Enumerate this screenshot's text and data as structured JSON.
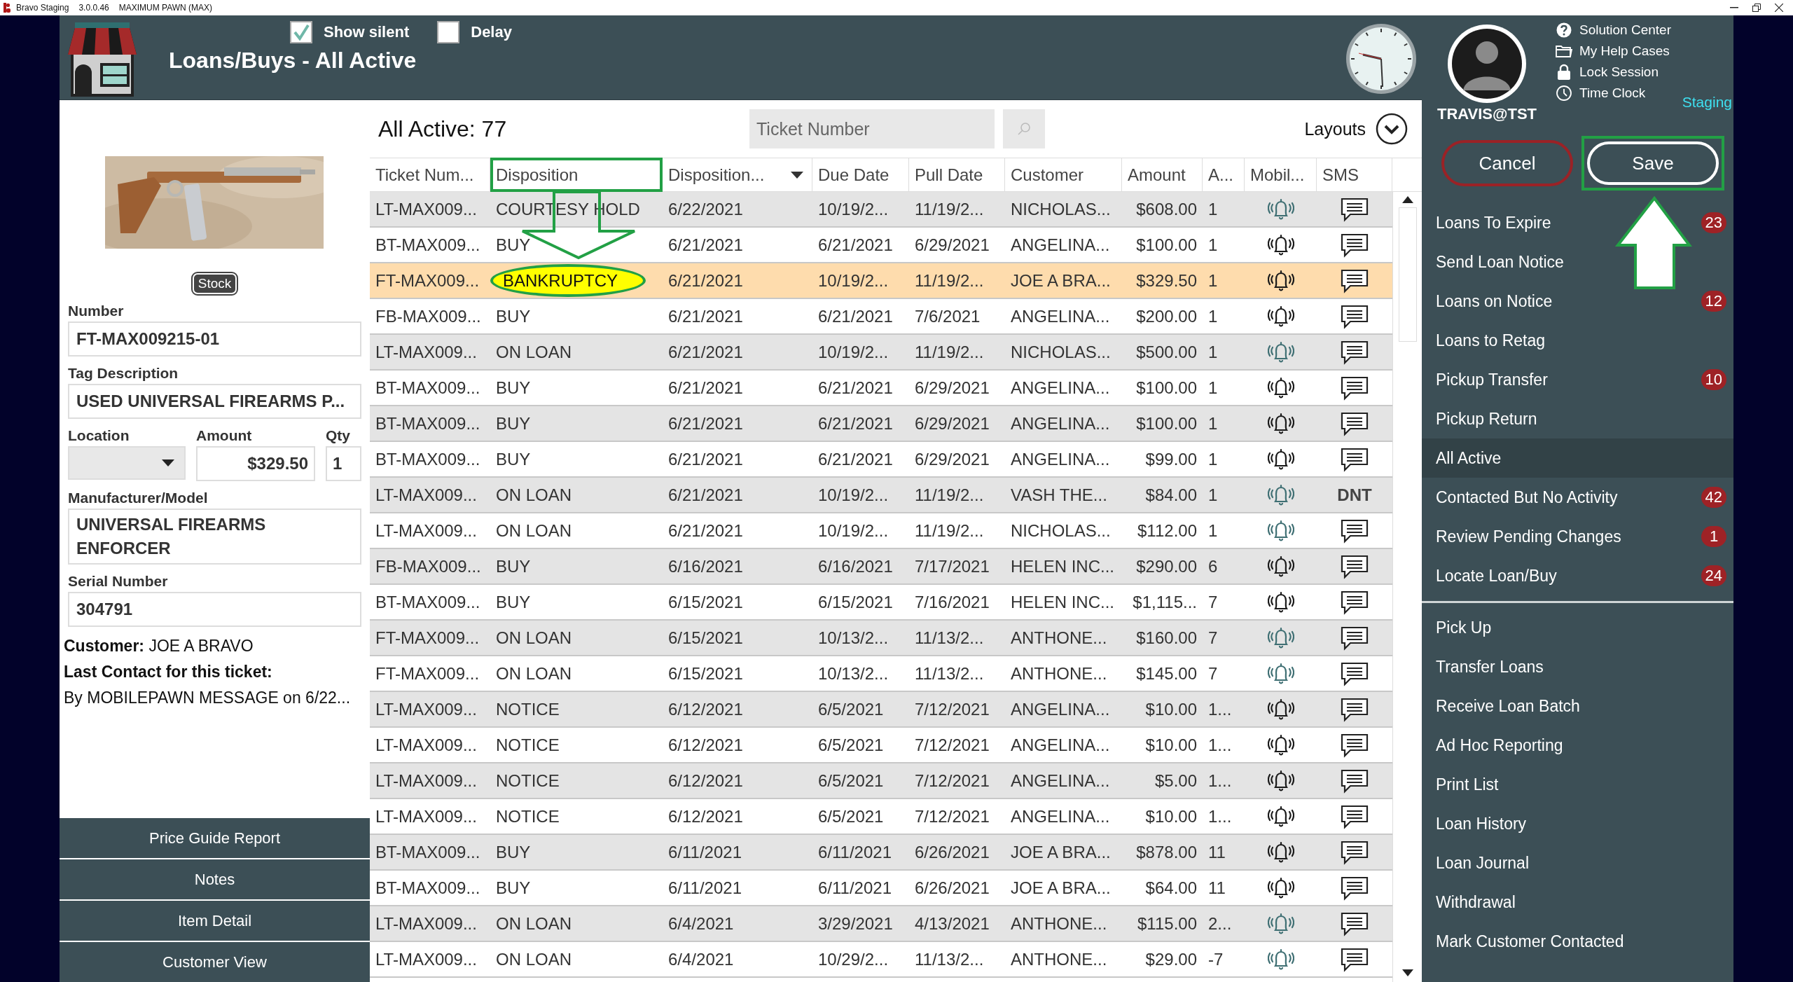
{
  "title_bar": {
    "app": "Bravo Staging",
    "version": "3.0.0.46",
    "store": "MAXIMUM PAWN (MAX)"
  },
  "header": {
    "title": "Loans/Buys - All Active",
    "options": [
      {
        "label": "Show silent",
        "checked": true
      },
      {
        "label": "Delay",
        "checked": false
      }
    ]
  },
  "item": {
    "stock_button": "Stock",
    "number": {
      "label": "Number",
      "value": "FT-MAX009215-01"
    },
    "tag_description": {
      "label": "Tag Description",
      "value": "USED UNIVERSAL FIREARMS P..."
    },
    "location": {
      "label": "Location"
    },
    "amount": {
      "label": "Amount",
      "value": "$329.50"
    },
    "qty": {
      "label": "Qty",
      "value": "1"
    },
    "model": {
      "label": "Manufacturer/Model",
      "value": "UNIVERSAL FIREARMS ENFORCER"
    },
    "serial": {
      "label": "Serial Number",
      "value": "304791"
    },
    "customer": "**Customer:** JOE A BRAVO",
    "last_contact_label": "Last Contact for this ticket:",
    "last_contact": "By MOBILEPAWN MESSAGE on 6/22..."
  },
  "actions": [
    "Price Guide Report",
    "Notes",
    "Item Detail",
    "Customer View"
  ],
  "list": {
    "title": "All Active: 77",
    "search_placeholder": "Ticket Number",
    "layouts": "Layouts",
    "columns": [
      {
        "label": "Ticket Num...",
        "sorted": false,
        "highlighted": false
      },
      {
        "label": "Disposition",
        "sorted": false,
        "highlighted": true
      },
      {
        "label": "Disposition...",
        "sorted": true,
        "highlighted": false
      },
      {
        "label": "Due Date",
        "sorted": false,
        "highlighted": false
      },
      {
        "label": "Pull Date",
        "sorted": false,
        "highlighted": false
      },
      {
        "label": "Customer",
        "sorted": false,
        "highlighted": false
      },
      {
        "label": "Amount",
        "sorted": false,
        "highlighted": false
      },
      {
        "label": "A...",
        "sorted": false,
        "highlighted": false
      },
      {
        "label": "Mobil...",
        "sorted": false,
        "highlighted": false
      },
      {
        "label": "SMS",
        "sorted": false,
        "highlighted": false
      }
    ],
    "rows": [
      {
        "ticket": "LT-MAX009...",
        "disposition": "COURTESY HOLD",
        "disposition_date": "6/22/2021",
        "due_date": "10/19/2...",
        "pull_date": "11/19/2...",
        "customer": "NICHOLAS...",
        "amount": "$608.00",
        "a": "1",
        "color": "#3f6f73",
        "kind": "chat",
        "selected": false,
        "highlighted": false
      },
      {
        "ticket": "BT-MAX009...",
        "disposition": "BUY",
        "disposition_date": "6/21/2021",
        "due_date": "6/21/2021",
        "pull_date": "6/29/2021",
        "customer": "ANGELINA...",
        "amount": "$100.00",
        "a": "1",
        "color": "#1a1a1a",
        "kind": "chat",
        "selected": false,
        "highlighted": false
      },
      {
        "ticket": "FT-MAX009...",
        "disposition": "BANKRUPTCY",
        "disposition_date": "6/21/2021",
        "due_date": "10/19/2...",
        "pull_date": "11/19/2...",
        "customer": "JOE A BRA...",
        "amount": "$329.50",
        "a": "1",
        "color": "#1a1a1a",
        "kind": "chat",
        "selected": true,
        "highlighted": true
      },
      {
        "ticket": "FB-MAX009...",
        "disposition": "BUY",
        "disposition_date": "6/21/2021",
        "due_date": "6/21/2021",
        "pull_date": "7/6/2021",
        "customer": "ANGELINA...",
        "amount": "$200.00",
        "a": "1",
        "color": "#1a1a1a",
        "kind": "chat",
        "selected": false,
        "highlighted": false
      },
      {
        "ticket": "LT-MAX009...",
        "disposition": "ON LOAN",
        "disposition_date": "6/21/2021",
        "due_date": "10/19/2...",
        "pull_date": "11/19/2...",
        "customer": "NICHOLAS...",
        "amount": "$500.00",
        "a": "1",
        "color": "#3f6f73",
        "kind": "chat",
        "selected": false,
        "highlighted": false
      },
      {
        "ticket": "BT-MAX009...",
        "disposition": "BUY",
        "disposition_date": "6/21/2021",
        "due_date": "6/21/2021",
        "pull_date": "6/29/2021",
        "customer": "ANGELINA...",
        "amount": "$100.00",
        "a": "1",
        "color": "#1a1a1a",
        "kind": "chat",
        "selected": false,
        "highlighted": false
      },
      {
        "ticket": "BT-MAX009...",
        "disposition": "BUY",
        "disposition_date": "6/21/2021",
        "due_date": "6/21/2021",
        "pull_date": "6/29/2021",
        "customer": "ANGELINA...",
        "amount": "$100.00",
        "a": "1",
        "color": "#1a1a1a",
        "kind": "chat",
        "selected": false,
        "highlighted": false
      },
      {
        "ticket": "BT-MAX009...",
        "disposition": "BUY",
        "disposition_date": "6/21/2021",
        "due_date": "6/21/2021",
        "pull_date": "6/29/2021",
        "customer": "ANGELINA...",
        "amount": "$99.00",
        "a": "1",
        "color": "#1a1a1a",
        "kind": "chat",
        "selected": false,
        "highlighted": false
      },
      {
        "ticket": "LT-MAX009...",
        "disposition": "ON LOAN",
        "disposition_date": "6/21/2021",
        "due_date": "10/19/2...",
        "pull_date": "11/19/2...",
        "customer": "VASH THE...",
        "amount": "$84.00",
        "a": "1",
        "color": "#3f6f73",
        "kind": "text",
        "sms": "DNT",
        "selected": false,
        "highlighted": false
      },
      {
        "ticket": "LT-MAX009...",
        "disposition": "ON LOAN",
        "disposition_date": "6/21/2021",
        "due_date": "10/19/2...",
        "pull_date": "11/19/2...",
        "customer": "NICHOLAS...",
        "amount": "$112.00",
        "a": "1",
        "color": "#3f6f73",
        "kind": "chat",
        "selected": false,
        "highlighted": false
      },
      {
        "ticket": "FB-MAX009...",
        "disposition": "BUY",
        "disposition_date": "6/16/2021",
        "due_date": "6/16/2021",
        "pull_date": "7/17/2021",
        "customer": "HELEN INC...",
        "amount": "$290.00",
        "a": "6",
        "color": "#1a1a1a",
        "kind": "chat",
        "selected": false,
        "highlighted": false
      },
      {
        "ticket": "BT-MAX009...",
        "disposition": "BUY",
        "disposition_date": "6/15/2021",
        "due_date": "6/15/2021",
        "pull_date": "7/16/2021",
        "customer": "HELEN INC...",
        "amount": "$1,115...",
        "a": "7",
        "color": "#1a1a1a",
        "kind": "chat",
        "selected": false,
        "highlighted": false
      },
      {
        "ticket": "FT-MAX009...",
        "disposition": "ON LOAN",
        "disposition_date": "6/15/2021",
        "due_date": "10/13/2...",
        "pull_date": "11/13/2...",
        "customer": "ANTHONE...",
        "amount": "$160.00",
        "a": "7",
        "color": "#3f6f73",
        "kind": "chat",
        "selected": false,
        "highlighted": false
      },
      {
        "ticket": "FT-MAX009...",
        "disposition": "ON LOAN",
        "disposition_date": "6/15/2021",
        "due_date": "10/13/2...",
        "pull_date": "11/13/2...",
        "customer": "ANTHONE...",
        "amount": "$145.00",
        "a": "7",
        "color": "#3f6f73",
        "kind": "chat",
        "selected": false,
        "highlighted": false
      },
      {
        "ticket": "LT-MAX009...",
        "disposition": "NOTICE",
        "disposition_date": "6/12/2021",
        "due_date": "6/5/2021",
        "pull_date": "7/12/2021",
        "customer": "ANGELINA...",
        "amount": "$10.00",
        "a": "1...",
        "color": "#1a1a1a",
        "kind": "chat",
        "selected": false,
        "highlighted": false
      },
      {
        "ticket": "LT-MAX009...",
        "disposition": "NOTICE",
        "disposition_date": "6/12/2021",
        "due_date": "6/5/2021",
        "pull_date": "7/12/2021",
        "customer": "ANGELINA...",
        "amount": "$10.00",
        "a": "1...",
        "color": "#1a1a1a",
        "kind": "chat",
        "selected": false,
        "highlighted": false
      },
      {
        "ticket": "LT-MAX009...",
        "disposition": "NOTICE",
        "disposition_date": "6/12/2021",
        "due_date": "6/5/2021",
        "pull_date": "7/12/2021",
        "customer": "ANGELINA...",
        "amount": "$5.00",
        "a": "1...",
        "color": "#1a1a1a",
        "kind": "chat",
        "selected": false,
        "highlighted": false
      },
      {
        "ticket": "LT-MAX009...",
        "disposition": "NOTICE",
        "disposition_date": "6/12/2021",
        "due_date": "6/5/2021",
        "pull_date": "7/12/2021",
        "customer": "ANGELINA...",
        "amount": "$10.00",
        "a": "1...",
        "color": "#1a1a1a",
        "kind": "chat",
        "selected": false,
        "highlighted": false
      },
      {
        "ticket": "BT-MAX009...",
        "disposition": "BUY",
        "disposition_date": "6/11/2021",
        "due_date": "6/11/2021",
        "pull_date": "6/26/2021",
        "customer": "JOE A BRA...",
        "amount": "$878.00",
        "a": "11",
        "color": "#1a1a1a",
        "kind": "chat",
        "selected": false,
        "highlighted": false
      },
      {
        "ticket": "BT-MAX009...",
        "disposition": "BUY",
        "disposition_date": "6/11/2021",
        "due_date": "6/11/2021",
        "pull_date": "6/26/2021",
        "customer": "JOE A BRA...",
        "amount": "$64.00",
        "a": "11",
        "color": "#1a1a1a",
        "kind": "chat",
        "selected": false,
        "highlighted": false
      },
      {
        "ticket": "LT-MAX009...",
        "disposition": "ON LOAN",
        "disposition_date": "6/4/2021",
        "due_date": "3/29/2021",
        "pull_date": "4/13/2021",
        "customer": "ANTHONE...",
        "amount": "$115.00",
        "a": "2...",
        "color": "#3f6f73",
        "kind": "chat",
        "selected": false,
        "highlighted": false
      },
      {
        "ticket": "LT-MAX009...",
        "disposition": "ON LOAN",
        "disposition_date": "6/4/2021",
        "due_date": "10/29/2...",
        "pull_date": "11/13/2...",
        "customer": "ANTHONE...",
        "amount": "$29.00",
        "a": "-7",
        "color": "#3f6f73",
        "kind": "chat",
        "selected": false,
        "highlighted": false
      }
    ]
  },
  "user": {
    "name": "TRAVIS@TST",
    "environment": "Staging",
    "links": [
      {
        "label": "Solution Center",
        "kind": "help"
      },
      {
        "label": "My Help Cases",
        "kind": "folder"
      },
      {
        "label": "Lock Session",
        "kind": "lock"
      },
      {
        "label": "Time Clock",
        "kind": "clock"
      }
    ]
  },
  "buttons": {
    "cancel": "Cancel",
    "save": "Save",
    "save_highlighted": true
  },
  "menu": [
    {
      "label": "Loans To Expire",
      "badge": "23",
      "selected": false
    },
    {
      "label": "Send Loan Notice",
      "selected": false
    },
    {
      "label": "Loans on Notice",
      "badge": "12",
      "selected": false
    },
    {
      "label": "Loans to Retag",
      "selected": false
    },
    {
      "label": "Pickup Transfer",
      "badge": "10",
      "selected": false
    },
    {
      "label": "Pickup Return",
      "selected": false
    },
    {
      "label": "All Active",
      "selected": true
    },
    {
      "label": "Contacted But No Activity",
      "badge": "42",
      "selected": false
    },
    {
      "label": "Review Pending Changes",
      "badge": "1",
      "selected": false
    },
    {
      "label": "Locate Loan/Buy",
      "badge": "24",
      "selected": false
    }
  ],
  "tasks": [
    "Pick Up",
    "Transfer Loans",
    "Receive Loan Batch",
    "Ad Hoc Reporting",
    "Print List",
    "Loan History",
    "Loan Journal",
    "Withdrawal",
    "Mark Customer Contacted"
  ]
}
